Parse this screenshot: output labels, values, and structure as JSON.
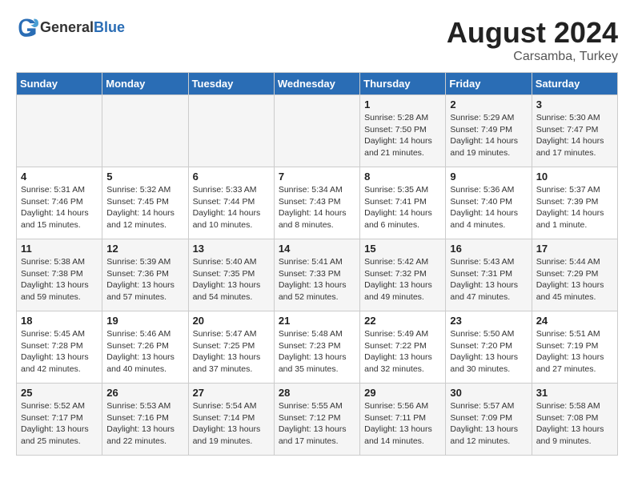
{
  "header": {
    "logo_general": "General",
    "logo_blue": "Blue",
    "month_year": "August 2024",
    "location": "Carsamba, Turkey"
  },
  "days_of_week": [
    "Sunday",
    "Monday",
    "Tuesday",
    "Wednesday",
    "Thursday",
    "Friday",
    "Saturday"
  ],
  "weeks": [
    [
      {
        "day": "",
        "info": ""
      },
      {
        "day": "",
        "info": ""
      },
      {
        "day": "",
        "info": ""
      },
      {
        "day": "",
        "info": ""
      },
      {
        "day": "1",
        "info": "Sunrise: 5:28 AM\nSunset: 7:50 PM\nDaylight: 14 hours\nand 21 minutes."
      },
      {
        "day": "2",
        "info": "Sunrise: 5:29 AM\nSunset: 7:49 PM\nDaylight: 14 hours\nand 19 minutes."
      },
      {
        "day": "3",
        "info": "Sunrise: 5:30 AM\nSunset: 7:47 PM\nDaylight: 14 hours\nand 17 minutes."
      }
    ],
    [
      {
        "day": "4",
        "info": "Sunrise: 5:31 AM\nSunset: 7:46 PM\nDaylight: 14 hours\nand 15 minutes."
      },
      {
        "day": "5",
        "info": "Sunrise: 5:32 AM\nSunset: 7:45 PM\nDaylight: 14 hours\nand 12 minutes."
      },
      {
        "day": "6",
        "info": "Sunrise: 5:33 AM\nSunset: 7:44 PM\nDaylight: 14 hours\nand 10 minutes."
      },
      {
        "day": "7",
        "info": "Sunrise: 5:34 AM\nSunset: 7:43 PM\nDaylight: 14 hours\nand 8 minutes."
      },
      {
        "day": "8",
        "info": "Sunrise: 5:35 AM\nSunset: 7:41 PM\nDaylight: 14 hours\nand 6 minutes."
      },
      {
        "day": "9",
        "info": "Sunrise: 5:36 AM\nSunset: 7:40 PM\nDaylight: 14 hours\nand 4 minutes."
      },
      {
        "day": "10",
        "info": "Sunrise: 5:37 AM\nSunset: 7:39 PM\nDaylight: 14 hours\nand 1 minute."
      }
    ],
    [
      {
        "day": "11",
        "info": "Sunrise: 5:38 AM\nSunset: 7:38 PM\nDaylight: 13 hours\nand 59 minutes."
      },
      {
        "day": "12",
        "info": "Sunrise: 5:39 AM\nSunset: 7:36 PM\nDaylight: 13 hours\nand 57 minutes."
      },
      {
        "day": "13",
        "info": "Sunrise: 5:40 AM\nSunset: 7:35 PM\nDaylight: 13 hours\nand 54 minutes."
      },
      {
        "day": "14",
        "info": "Sunrise: 5:41 AM\nSunset: 7:33 PM\nDaylight: 13 hours\nand 52 minutes."
      },
      {
        "day": "15",
        "info": "Sunrise: 5:42 AM\nSunset: 7:32 PM\nDaylight: 13 hours\nand 49 minutes."
      },
      {
        "day": "16",
        "info": "Sunrise: 5:43 AM\nSunset: 7:31 PM\nDaylight: 13 hours\nand 47 minutes."
      },
      {
        "day": "17",
        "info": "Sunrise: 5:44 AM\nSunset: 7:29 PM\nDaylight: 13 hours\nand 45 minutes."
      }
    ],
    [
      {
        "day": "18",
        "info": "Sunrise: 5:45 AM\nSunset: 7:28 PM\nDaylight: 13 hours\nand 42 minutes."
      },
      {
        "day": "19",
        "info": "Sunrise: 5:46 AM\nSunset: 7:26 PM\nDaylight: 13 hours\nand 40 minutes."
      },
      {
        "day": "20",
        "info": "Sunrise: 5:47 AM\nSunset: 7:25 PM\nDaylight: 13 hours\nand 37 minutes."
      },
      {
        "day": "21",
        "info": "Sunrise: 5:48 AM\nSunset: 7:23 PM\nDaylight: 13 hours\nand 35 minutes."
      },
      {
        "day": "22",
        "info": "Sunrise: 5:49 AM\nSunset: 7:22 PM\nDaylight: 13 hours\nand 32 minutes."
      },
      {
        "day": "23",
        "info": "Sunrise: 5:50 AM\nSunset: 7:20 PM\nDaylight: 13 hours\nand 30 minutes."
      },
      {
        "day": "24",
        "info": "Sunrise: 5:51 AM\nSunset: 7:19 PM\nDaylight: 13 hours\nand 27 minutes."
      }
    ],
    [
      {
        "day": "25",
        "info": "Sunrise: 5:52 AM\nSunset: 7:17 PM\nDaylight: 13 hours\nand 25 minutes."
      },
      {
        "day": "26",
        "info": "Sunrise: 5:53 AM\nSunset: 7:16 PM\nDaylight: 13 hours\nand 22 minutes."
      },
      {
        "day": "27",
        "info": "Sunrise: 5:54 AM\nSunset: 7:14 PM\nDaylight: 13 hours\nand 19 minutes."
      },
      {
        "day": "28",
        "info": "Sunrise: 5:55 AM\nSunset: 7:12 PM\nDaylight: 13 hours\nand 17 minutes."
      },
      {
        "day": "29",
        "info": "Sunrise: 5:56 AM\nSunset: 7:11 PM\nDaylight: 13 hours\nand 14 minutes."
      },
      {
        "day": "30",
        "info": "Sunrise: 5:57 AM\nSunset: 7:09 PM\nDaylight: 13 hours\nand 12 minutes."
      },
      {
        "day": "31",
        "info": "Sunrise: 5:58 AM\nSunset: 7:08 PM\nDaylight: 13 hours\nand 9 minutes."
      }
    ]
  ]
}
